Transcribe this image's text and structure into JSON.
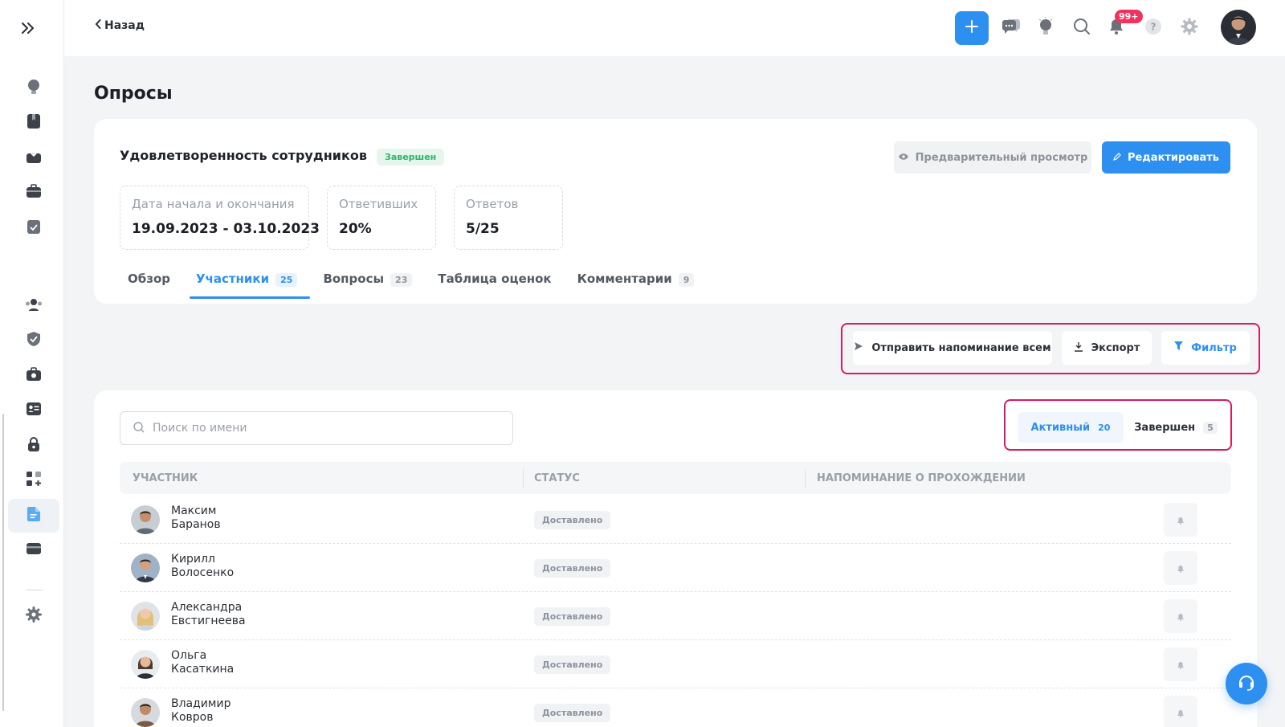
{
  "header": {
    "back_label": "Назад",
    "notification_count": "99+",
    "icons": [
      "plus-icon",
      "chat-icon",
      "lightbulb-icon",
      "search-icon",
      "bell-icon",
      "help-icon",
      "gear-icon"
    ]
  },
  "sidebar": {
    "items": [
      "lightbulb-icon",
      "bookmark-icon",
      "inbox-icon",
      "briefcase-icon",
      "clipboard-icon",
      "users-icon",
      "shield-icon",
      "team-briefcase-icon",
      "id-card-icon",
      "lock-icon",
      "apps-add-icon",
      "document-icon",
      "card-icon",
      "gear-icon"
    ],
    "active": "document-icon"
  },
  "page": {
    "title": "Опросы"
  },
  "survey": {
    "name": "Удовлетворенность сотрудников",
    "status": "Завершен",
    "preview_label": "Предварительный просмотр",
    "edit_label": "Редактировать",
    "stats": [
      {
        "label": "Дата начала и окончания",
        "value": "19.09.2023 - 03.10.2023"
      },
      {
        "label": "Ответивших",
        "value": "20%"
      },
      {
        "label": "Ответов",
        "value": "5/25"
      }
    ],
    "tabs": [
      {
        "label": "Обзор",
        "count": ""
      },
      {
        "label": "Участники",
        "count": "25"
      },
      {
        "label": "Вопросы",
        "count": "23"
      },
      {
        "label": "Таблица оценок",
        "count": ""
      },
      {
        "label": "Комментарии",
        "count": "9"
      }
    ],
    "active_tab": "Участники"
  },
  "actions": {
    "remind_all": "Отправить напоминание всем",
    "export": "Экспорт",
    "filter": "Фильтр"
  },
  "participants": {
    "search_placeholder": "Поиск по имени",
    "segments": [
      {
        "label": "Активный",
        "count": "20"
      },
      {
        "label": "Завершен",
        "count": "5"
      }
    ],
    "columns": [
      "Участник",
      "Статус",
      "Напоминание о прохождении"
    ],
    "rows": [
      {
        "first": "Максим",
        "last": "Баранов",
        "status": "Доставлено"
      },
      {
        "first": "Кирилл",
        "last": "Волосенко",
        "status": "Доставлено"
      },
      {
        "first": "Александра",
        "last": "Евстигнеева",
        "status": "Доставлено"
      },
      {
        "first": "Ольга",
        "last": "Касаткина",
        "status": "Доставлено"
      },
      {
        "first": "Владимир",
        "last": "Ковров",
        "status": "Доставлено"
      }
    ]
  },
  "colors": {
    "accent": "#2d8ff0",
    "highlight": "#d81b60",
    "success": "#2db567",
    "badge": "#f2325c"
  }
}
